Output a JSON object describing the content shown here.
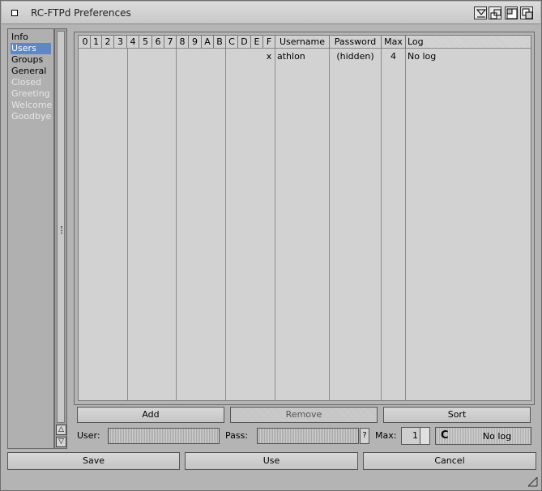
{
  "window": {
    "title": "RC-FTPd Preferences"
  },
  "sidebar": {
    "items": [
      {
        "label": "Info",
        "state": "normal"
      },
      {
        "label": "Users",
        "state": "selected"
      },
      {
        "label": "Groups",
        "state": "normal"
      },
      {
        "label": "General",
        "state": "normal"
      },
      {
        "label": "Closed",
        "state": "disabled"
      },
      {
        "label": "Greeting",
        "state": "disabled"
      },
      {
        "label": "Welcome",
        "state": "disabled"
      },
      {
        "label": "Goodbye",
        "state": "disabled"
      }
    ]
  },
  "users_list": {
    "columns": [
      "0",
      "1",
      "2",
      "3",
      "4",
      "5",
      "6",
      "7",
      "8",
      "9",
      "A",
      "B",
      "C",
      "D",
      "E",
      "F",
      "Username",
      "Password",
      "Max",
      "Log"
    ],
    "rows": [
      {
        "flag_f": "x",
        "username": "athlon",
        "password": "(hidden)",
        "max": "4",
        "log": "No log"
      }
    ]
  },
  "actions": {
    "add": "Add",
    "remove": "Remove",
    "sort": "Sort"
  },
  "form": {
    "user_label": "User:",
    "user_value": "",
    "pass_label": "Pass:",
    "pass_value": "",
    "pass_help": "?",
    "max_label": "Max:",
    "max_value": "1",
    "log_value": "No log",
    "log_cycle_icon": "C"
  },
  "footer": {
    "save": "Save",
    "use": "Use",
    "cancel": "Cancel"
  },
  "colors": {
    "selection": "#5e86c8",
    "window_bg": "#b4b4b4",
    "list_bg": "#d2d2d2"
  }
}
